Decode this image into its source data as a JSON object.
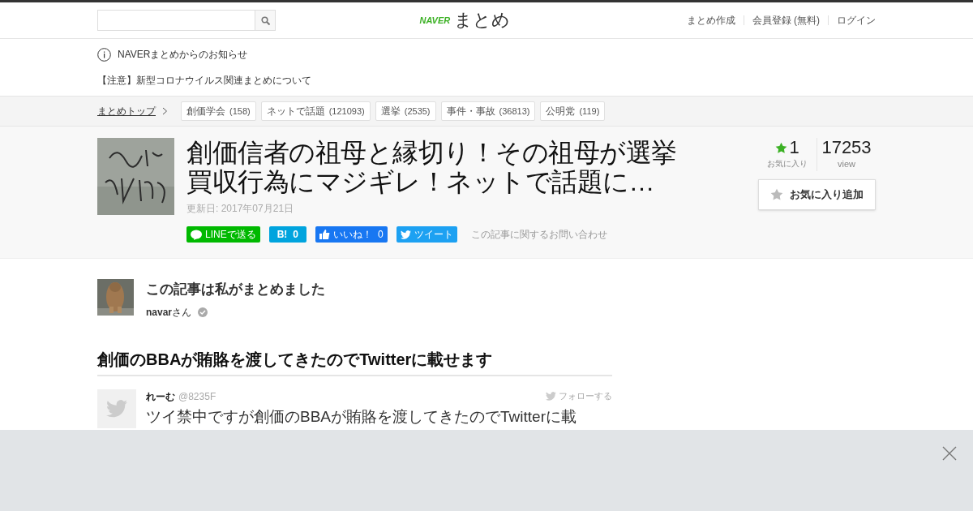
{
  "header": {
    "logo": {
      "brand": "NAVER",
      "name": "まとめ"
    },
    "links": [
      "まとめ作成",
      "会員登録 (無料)",
      "ログイン"
    ]
  },
  "notice": {
    "title": "NAVERまとめからのお知らせ",
    "link": "【注意】新型コロナウイルス関連まとめについて"
  },
  "breadcrumb": {
    "home": "まとめトップ",
    "tags": [
      {
        "name": "創価学会",
        "count": "(158)"
      },
      {
        "name": "ネットで話題",
        "count": "(121093)"
      },
      {
        "name": "選挙",
        "count": "(2535)"
      },
      {
        "name": "事件・事故",
        "count": "(36813)"
      },
      {
        "name": "公明党",
        "count": "(119)"
      }
    ]
  },
  "article": {
    "title": "創価信者の祖母と縁切り！その祖母が選挙買収行為にマジギレ！ネットで話題に…",
    "updated": "更新日: 2017年07月21日",
    "share": [
      {
        "kind": "line",
        "label": "LINEで送る"
      },
      {
        "kind": "hatena",
        "label": "B!",
        "count": "0"
      },
      {
        "kind": "facebook",
        "label": "いいね！",
        "count": "0"
      },
      {
        "kind": "twitter",
        "label": "ツイート"
      }
    ],
    "contact": "この記事に関するお問い合わせ",
    "favorites": {
      "count": "1",
      "label": "お気に入り"
    },
    "views": {
      "count": "17253",
      "label": "view"
    },
    "favorite_button": "お気に入り追加"
  },
  "author": {
    "heading": "この記事は私がまとめました",
    "name": "navar",
    "suffix": "さん",
    "verified": true
  },
  "section": {
    "heading": "創価のBBAが賄賂を渡してきたのでTwitterに載せます"
  },
  "tweet": {
    "name": "れーむ",
    "handle": "@8235F",
    "follow": "フォローする",
    "text": "ツイ禁中ですが創価のBBAが賄賂を渡してきたのでTwitterに載"
  }
}
